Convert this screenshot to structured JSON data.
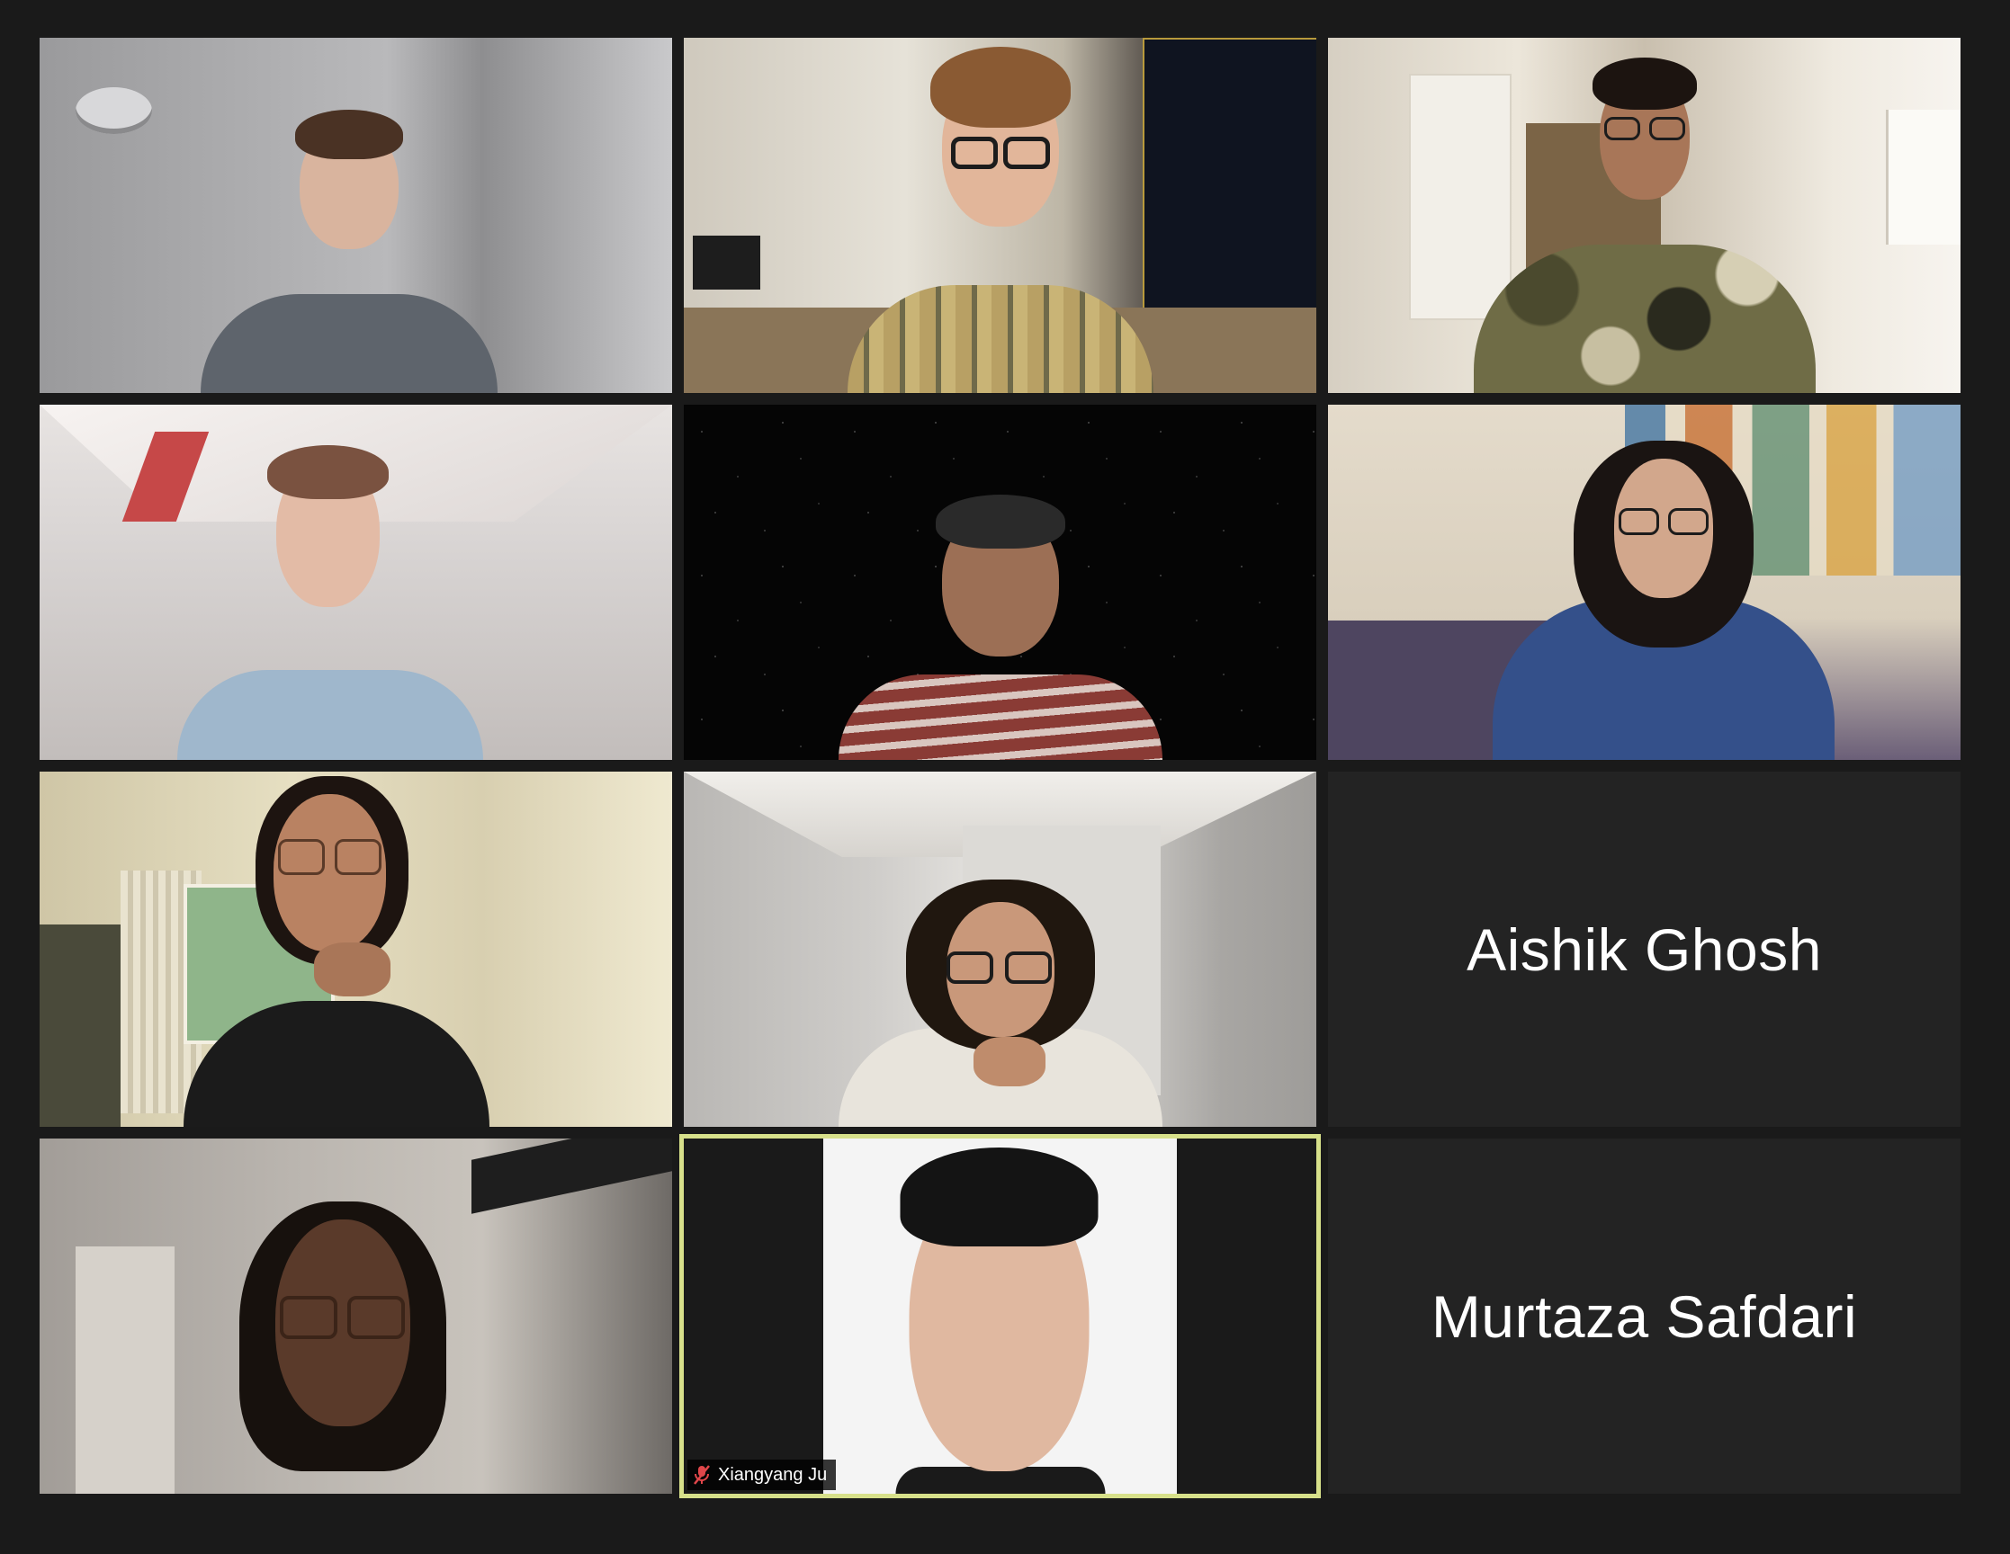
{
  "meeting": {
    "view": "gallery",
    "participants": [
      {
        "name": "",
        "video": "on"
      },
      {
        "name": "",
        "video": "on"
      },
      {
        "name": "",
        "video": "on"
      },
      {
        "name": "",
        "video": "on"
      },
      {
        "name": "",
        "video": "on"
      },
      {
        "name": "",
        "video": "on"
      },
      {
        "name": "",
        "video": "on"
      },
      {
        "name": "",
        "video": "on"
      },
      {
        "name": "Aishik Ghosh",
        "video": "off"
      },
      {
        "name": "",
        "video": "on"
      },
      {
        "name": "Xiangyang Ju",
        "video": "on",
        "muted": true,
        "active_speaker": true
      },
      {
        "name": "Murtaza Safdari",
        "video": "off"
      }
    ]
  },
  "colors": {
    "background": "#1a1a1a",
    "tile_off": "#232323",
    "active_speaker_border": "#d7e08a",
    "muted_icon": "#e0464a"
  },
  "icons": {
    "muted": "mic-muted-icon"
  }
}
